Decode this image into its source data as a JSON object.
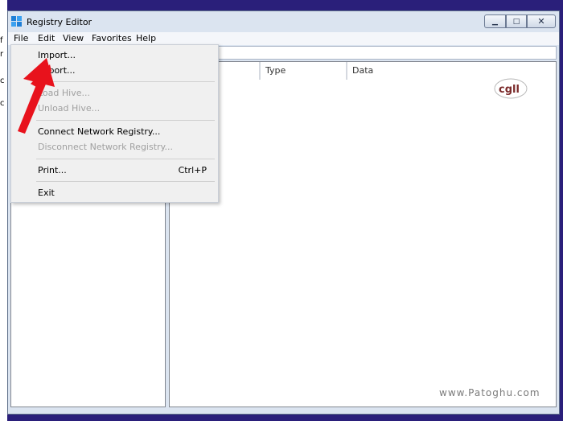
{
  "window": {
    "title": "Registry Editor",
    "controls": {
      "minimize": "▁",
      "maximize": "□",
      "close": "✕"
    }
  },
  "menubar": {
    "items": [
      "File",
      "Edit",
      "View",
      "Favorites",
      "Help"
    ]
  },
  "list": {
    "columns": [
      "",
      "Type",
      "Data"
    ]
  },
  "file_menu": {
    "items": [
      {
        "label": "Import...",
        "enabled": true,
        "shortcut": ""
      },
      {
        "label": "Export...",
        "enabled": true,
        "shortcut": ""
      },
      {
        "label": "Load Hive...",
        "enabled": false,
        "shortcut": ""
      },
      {
        "label": "Unload Hive...",
        "enabled": false,
        "shortcut": ""
      },
      {
        "label": "Connect Network Registry...",
        "enabled": true,
        "shortcut": ""
      },
      {
        "label": "Disconnect Network Registry...",
        "enabled": false,
        "shortcut": ""
      },
      {
        "label": "Print...",
        "enabled": true,
        "shortcut": "Ctrl+P"
      },
      {
        "label": "Exit",
        "enabled": true,
        "shortcut": ""
      }
    ]
  },
  "overlay": {
    "arrow_color": "#e8121c",
    "logo_text": "cgll",
    "watermark": "www.Patoghu.com"
  },
  "desktop_strip": [
    "f",
    "r",
    "c",
    "c"
  ],
  "colors": {
    "desktop": "#2a1f7a",
    "window_frame": "#dbe4f0",
    "disabled_text": "#a0a0a0"
  }
}
